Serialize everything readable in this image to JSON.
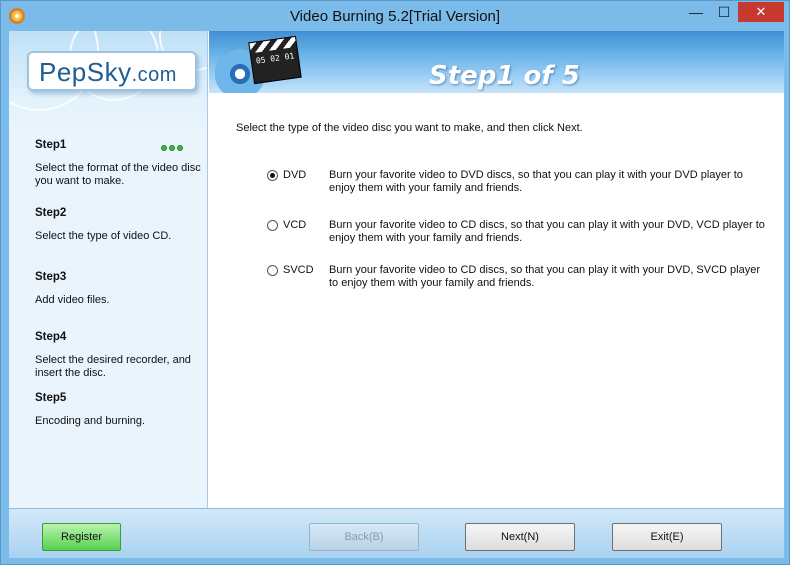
{
  "window": {
    "title": "Video Burning 5.2[Trial Version]",
    "minimize_glyph": "—",
    "maximize_glyph": "☐",
    "close_glyph": "✕"
  },
  "logo": {
    "brand": "PepSky",
    "suffix": ".com"
  },
  "header": {
    "step_heading": "Step1 of 5",
    "clapper_text": "05 02 01"
  },
  "steps": [
    {
      "title": "Step1",
      "desc": "Select the format of the video disc you want to make.",
      "active": true
    },
    {
      "title": "Step2",
      "desc": "Select the type of video CD."
    },
    {
      "title": "Step3",
      "desc": "Add video files."
    },
    {
      "title": "Step4",
      "desc": "Select the desired recorder, and insert the disc."
    },
    {
      "title": "Step5",
      "desc": "Encoding and burning."
    }
  ],
  "main": {
    "instruction": "Select the type of the video disc you want to make, and then click Next.",
    "options": [
      {
        "label": "DVD",
        "desc": "Burn your favorite video to DVD discs, so that you can play it with your DVD player to enjoy them with your family and friends.",
        "selected": true
      },
      {
        "label": "VCD",
        "desc": "Burn your favorite video to CD discs, so that you can play it with your DVD, VCD player to enjoy them with your family and friends.",
        "selected": false
      },
      {
        "label": "SVCD",
        "desc": "Burn your favorite video to CD discs, so that you can play it with your DVD, SVCD player to enjoy them with your family and friends.",
        "selected": false
      }
    ]
  },
  "footer": {
    "register_label": "Register",
    "back_label": "Back(B)",
    "next_label": "Next(N)",
    "exit_label": "Exit(E)"
  },
  "colors": {
    "accent": "#3f8fd2",
    "register_green": "#57d04f",
    "close_red": "#c7392f"
  }
}
